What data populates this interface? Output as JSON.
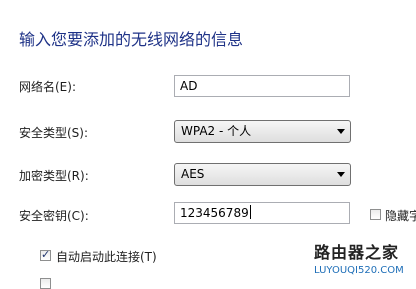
{
  "header": {
    "title": "输入您要添加的无线网络的信息"
  },
  "form": {
    "network_name": {
      "label": "网络名(E):",
      "value": "AD"
    },
    "security_type": {
      "label": "安全类型(S):",
      "selected": "WPA2 - 个人"
    },
    "encryption_type": {
      "label": "加密类型(R):",
      "selected": "AES"
    },
    "security_key": {
      "label": "安全密钥(C):",
      "value": "123456789"
    },
    "hide_chars": {
      "label": "隐藏字",
      "checked": false
    },
    "auto_connect": {
      "label": "自动启动此连接(T)",
      "checked": true
    }
  },
  "watermark": {
    "cn": "路由器之家",
    "en": "LUYOUQI520.COM"
  }
}
